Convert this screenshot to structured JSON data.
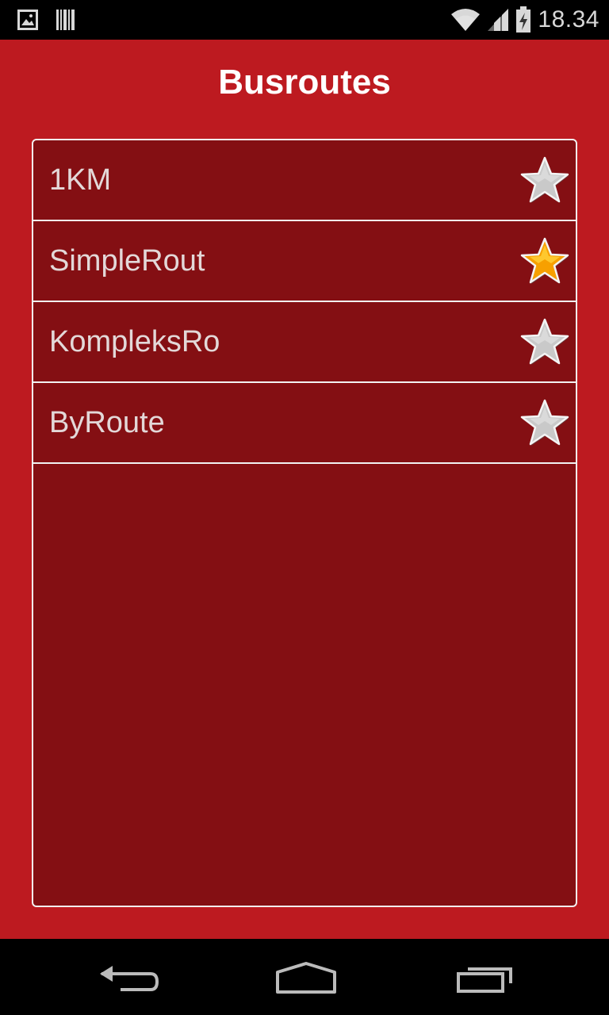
{
  "status_bar": {
    "time": "18.34",
    "icons": [
      "image-notification-icon",
      "barcode-notification-icon",
      "wifi-icon",
      "cell-signal-icon",
      "battery-charging-icon"
    ]
  },
  "header": {
    "title": "Busroutes"
  },
  "routes": [
    {
      "name": "1KM",
      "favorite": false
    },
    {
      "name": "SimpleRout",
      "favorite": true
    },
    {
      "name": "KompleksRo",
      "favorite": false
    },
    {
      "name": "ByRoute",
      "favorite": false
    }
  ],
  "colors": {
    "app_background": "#bd1a20",
    "list_background": "#840f13",
    "star_favorite": "#f7a000",
    "star_default": "#c9c9c9"
  },
  "nav_bar": {
    "buttons": [
      "back-icon",
      "home-icon",
      "recent-apps-icon"
    ]
  }
}
